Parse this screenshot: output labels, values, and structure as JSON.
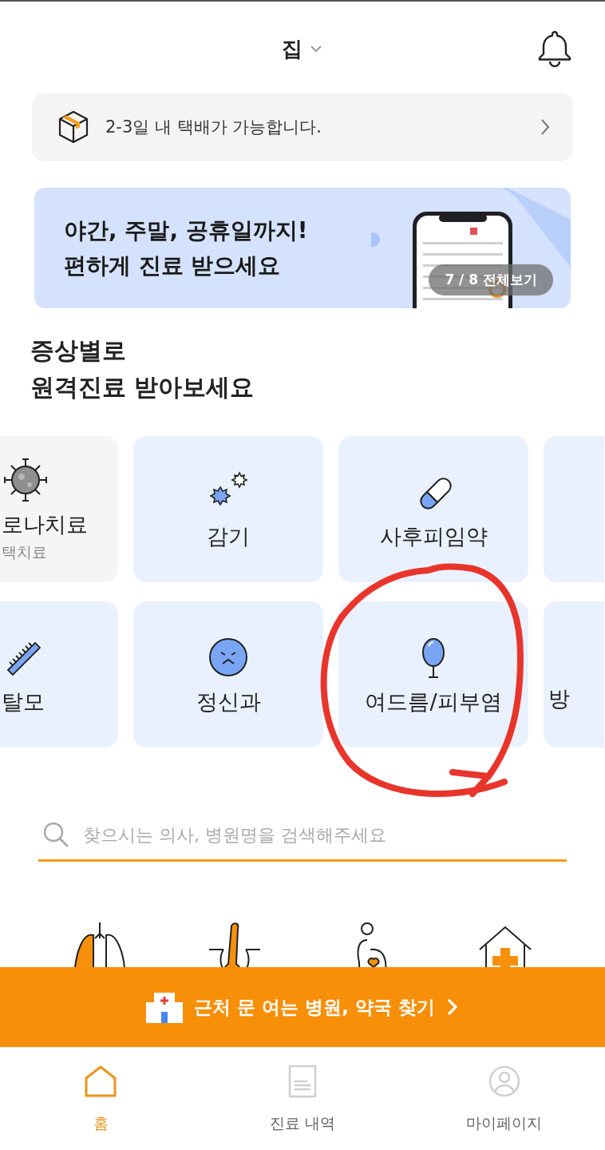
{
  "header": {
    "location": "집"
  },
  "delivery_notice": {
    "text": "2-3일 내 택배가 가능합니다."
  },
  "banner": {
    "lines": [
      "야간, 주말, 공휴일까지!",
      "편하게 진료 받으세요"
    ],
    "counter": "7 / 8 전체보기"
  },
  "section_title": [
    "증상별로",
    "원격진료 받아보세요"
  ],
  "symptom_rows": [
    [
      {
        "kind": "virus",
        "label": "로나치료",
        "sublabel": "택치료"
      },
      {
        "kind": "cold",
        "label": "감기"
      },
      {
        "kind": "pill",
        "label": "사후피임약"
      },
      {
        "kind": "blank"
      }
    ],
    [
      {
        "kind": "comb",
        "label": "탈모"
      },
      {
        "kind": "face",
        "label": "정신과"
      },
      {
        "kind": "mirror",
        "label": "여드름/피부염"
      },
      {
        "kind": "blank",
        "label": "방"
      }
    ]
  ],
  "search": {
    "placeholder": "찾으시는 의사, 병원명을 검색해주세요"
  },
  "quick_icons": [
    {
      "kind": "lungs"
    },
    {
      "kind": "hair"
    },
    {
      "kind": "pregnant"
    },
    {
      "kind": "house"
    }
  ],
  "floating_button": {
    "label": "근처 문 여는 병원, 약국 찾기"
  },
  "annotations": [
    {
      "kind": "hand_circle",
      "color": "#e8352c"
    }
  ],
  "bottom_nav": [
    {
      "kind": "home",
      "label": "홈",
      "selected": true
    },
    {
      "kind": "document",
      "label": "진료 내역",
      "selected": false
    },
    {
      "kind": "person",
      "label": "마이페이지",
      "selected": false
    }
  ]
}
